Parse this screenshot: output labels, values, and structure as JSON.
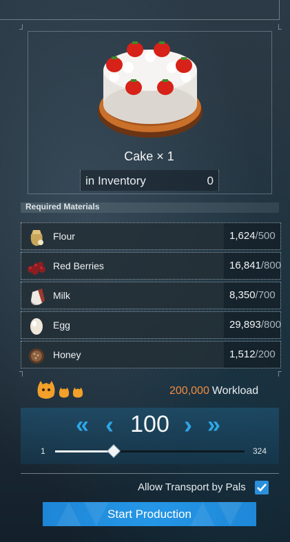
{
  "item": {
    "name": "Cake",
    "times": "×",
    "quantity": "1",
    "inventory_label": "in Inventory",
    "inventory_value": "0"
  },
  "required_header": "Required Materials",
  "materials": [
    {
      "name": "Flour",
      "have": "1,624",
      "need": "/500",
      "icon": "flour-sack-icon"
    },
    {
      "name": "Red Berries",
      "have": "16,841",
      "need": "/800",
      "icon": "red-berries-icon"
    },
    {
      "name": "Milk",
      "have": "8,350",
      "need": "/700",
      "icon": "milk-icon"
    },
    {
      "name": "Egg",
      "have": "29,893",
      "need": "/800",
      "icon": "egg-icon"
    },
    {
      "name": "Honey",
      "have": "1,512",
      "need": "/200",
      "icon": "honey-icon"
    }
  ],
  "workload": {
    "value": "200,000",
    "label": "Workload"
  },
  "stepper": {
    "count": "100",
    "min": "1",
    "max": "324",
    "fast_left": "«",
    "left": "‹",
    "right": "›",
    "fast_right": "»",
    "slider_fraction": 0.306
  },
  "transport_label": "Allow Transport by Pals",
  "transport_checked": true,
  "start_label": "Start Production",
  "colors": {
    "accent_blue": "#2596e6",
    "workload_orange": "#f08d3f",
    "chevron_blue": "#2ea6e6"
  }
}
